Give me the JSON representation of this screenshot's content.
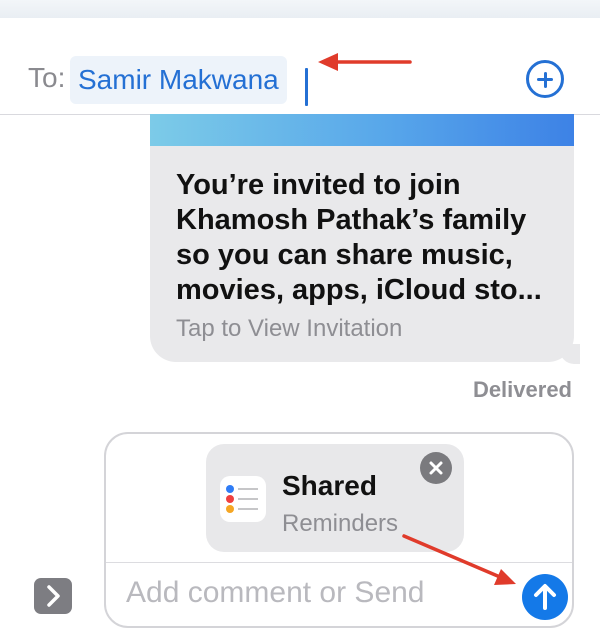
{
  "header": {
    "to_label": "To:",
    "recipient": "Samir Makwana",
    "add_button_icon": "plus-circle-icon"
  },
  "message": {
    "lines": [
      "You’re invited to join",
      "Khamosh Pathak’s family",
      "so you can share music,",
      "movies, apps, iCloud sto..."
    ],
    "subtitle": "Tap to View Invitation",
    "status": "Delivered"
  },
  "compose": {
    "attachment": {
      "icon": "reminders-icon",
      "title": "Shared",
      "subtitle": "Reminders",
      "remove_icon": "close-icon"
    },
    "placeholder": "Add comment or Send",
    "send_icon": "arrow-up-icon",
    "expand_icon": "chevron-right-icon"
  },
  "annotations": {
    "arrow_color": "#e03b2b"
  },
  "colors": {
    "accent": "#2470d4",
    "send": "#1479e8",
    "bubble": "#e9e9eb"
  }
}
